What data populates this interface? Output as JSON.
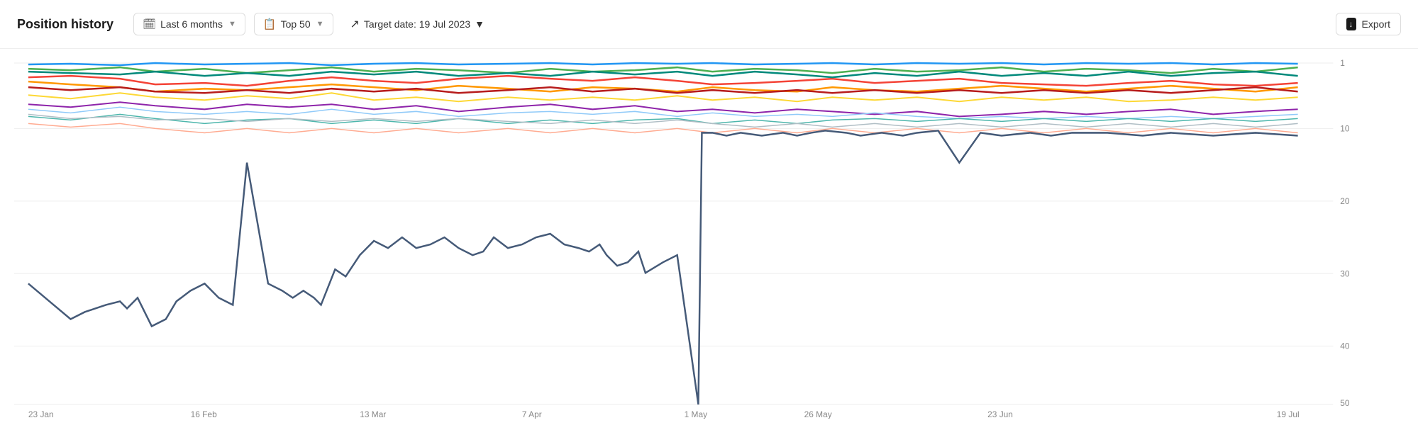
{
  "toolbar": {
    "title": "Position history",
    "period_label": "Last 6 months",
    "top_label": "Top 50",
    "target_date_label": "Target date: 19 Jul 2023",
    "export_label": "Export"
  },
  "chart": {
    "x_labels": [
      "23 Jan",
      "16 Feb",
      "13 Mar",
      "7 Apr",
      "1 May",
      "26 May",
      "23 Jun",
      "19 Jul"
    ],
    "y_labels": [
      "1",
      "10",
      "20",
      "30",
      "40",
      "50"
    ],
    "colors": {
      "blue_top": "#2196F3",
      "green1": "#4CAF50",
      "red": "#F44336",
      "orange": "#FF9800",
      "teal": "#009688",
      "yellow": "#FFC107",
      "purple": "#9C27B0",
      "dark_red": "#C62828",
      "light_blue": "#90CAF9",
      "light_green": "#A5D6A7",
      "peach": "#FFCCBC",
      "main_line": "#5C7A9E"
    }
  }
}
